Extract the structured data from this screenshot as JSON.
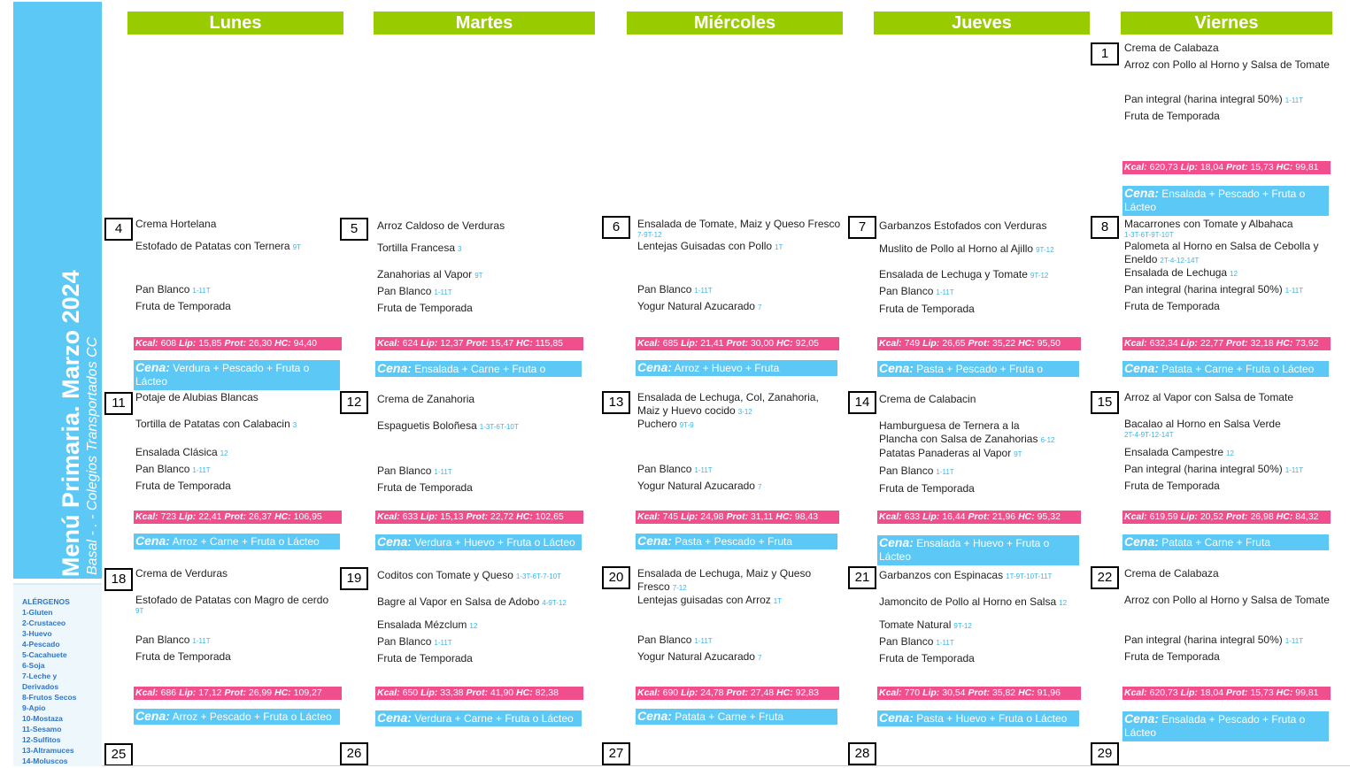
{
  "title": "Menú Primaria. Marzo 2024",
  "subtitle": "Basal - . - Colegios Transportados CC",
  "allergens": {
    "heading": "ALÉRGENOS",
    "items": [
      "1-Gluten",
      "2-Crustaceo",
      "3-Huevo",
      "4-Pescado",
      "5-Cacahuete",
      "6-Soja",
      "7-Leche y",
      "Derivados",
      "8-Frutos Secos",
      "9-Apio",
      "10-Mostaza",
      "11-Sesamo",
      "12-Sulfitos",
      "13-Altramuces",
      "14-Moluscos"
    ]
  },
  "days": [
    "Lunes",
    "Martes",
    "Miércoles",
    "Jueves",
    "Viernes"
  ],
  "dates": [
    "1",
    "4",
    "5",
    "6",
    "7",
    "8",
    "11",
    "12",
    "13",
    "14",
    "15",
    "18",
    "19",
    "20",
    "21",
    "22",
    "25",
    "26",
    "27",
    "28",
    "29"
  ],
  "colors": {
    "header": "#99cc00",
    "sidebar": "#5bc8f5",
    "kcal": "#f04e8c",
    "cena": "#5bc8f5",
    "allergen": "#3cb4e6"
  },
  "dishes": [
    {
      "t": "Crema de Calabaza",
      "a": ""
    },
    {
      "t": "Arroz con Pollo al Horno y Salsa de Tomate",
      "a": ""
    },
    {
      "t": "Pan integral (harina integral 50%)",
      "a": "1-11T"
    },
    {
      "t": "Fruta de Temporada",
      "a": ""
    },
    {
      "t": "Crema Hortelana",
      "a": ""
    },
    {
      "t": "Estofado de Patatas con Ternera",
      "a": "9T"
    },
    {
      "t": "Pan Blanco",
      "a": "1-11T"
    },
    {
      "t": "Fruta de Temporada",
      "a": ""
    },
    {
      "t": "Arroz Caldoso de Verduras",
      "a": ""
    },
    {
      "t": "Tortilla Francesa",
      "a": "3"
    },
    {
      "t": "Zanahorias al Vapor",
      "a": "9T"
    },
    {
      "t": "Pan Blanco",
      "a": "1-11T"
    },
    {
      "t": "Fruta de Temporada",
      "a": ""
    },
    {
      "t": "Ensalada de Tomate, Maiz y Queso Fresco",
      "a": "7-9T-12"
    },
    {
      "t": "Lentejas Guisadas con Pollo",
      "a": "1T"
    },
    {
      "t": "Pan Blanco",
      "a": "1-11T"
    },
    {
      "t": "Yogur Natural Azucarado",
      "a": "7"
    },
    {
      "t": "Garbanzos Estofados con Verduras",
      "a": ""
    },
    {
      "t": "Muslito de Pollo al Horno al Ajillo",
      "a": "9T-12"
    },
    {
      "t": "Ensalada de Lechuga y Tomate",
      "a": "9T-12"
    },
    {
      "t": "Pan Blanco",
      "a": "1-11T"
    },
    {
      "t": "Fruta de Temporada",
      "a": ""
    },
    {
      "t": "Macarrones con Tomate y Albahaca",
      "a": "1-3T-6T-9T-10T"
    },
    {
      "t": "Palometa al Horno en Salsa de Cebolla y Eneldo",
      "a": "2T-4-12-14T"
    },
    {
      "t": "Ensalada de Lechuga",
      "a": "12"
    },
    {
      "t": "Pan integral (harina integral 50%)",
      "a": "1-11T"
    },
    {
      "t": "Fruta de Temporada",
      "a": ""
    },
    {
      "t": "Potaje de Alubias Blancas",
      "a": ""
    },
    {
      "t": "Tortilla de Patatas con Calabacin",
      "a": "3"
    },
    {
      "t": "Ensalada Clásica",
      "a": "12"
    },
    {
      "t": "Pan Blanco",
      "a": "1-11T"
    },
    {
      "t": "Fruta de Temporada",
      "a": ""
    },
    {
      "t": "Crema de Zanahoria",
      "a": ""
    },
    {
      "t": "Espaguetis Boloñesa",
      "a": "1-3T-6T-10T"
    },
    {
      "t": "Pan Blanco",
      "a": "1-11T"
    },
    {
      "t": "Fruta de Temporada",
      "a": ""
    },
    {
      "t": "Ensalada de Lechuga, Col, Zanahoria, Maiz y Huevo cocido",
      "a": "3-12"
    },
    {
      "t": "Puchero",
      "a": "9T-9"
    },
    {
      "t": "Pan Blanco",
      "a": "1-11T"
    },
    {
      "t": "Yogur Natural Azucarado",
      "a": "7"
    },
    {
      "t": "Crema de Calabacin",
      "a": ""
    },
    {
      "t": "Hamburguesa de Ternera a la Plancha con Salsa de Zanahorias",
      "a": "6-12"
    },
    {
      "t": "Patatas Panaderas al Vapor",
      "a": "9T"
    },
    {
      "t": "Pan Blanco",
      "a": "1-11T"
    },
    {
      "t": "Fruta de Temporada",
      "a": ""
    },
    {
      "t": "Arroz al Vapor con Salsa de Tomate",
      "a": ""
    },
    {
      "t": "Bacalao al Horno en Salsa Verde",
      "a": "2T-4-9T-12-14T"
    },
    {
      "t": "Ensalada Campestre",
      "a": "12"
    },
    {
      "t": "Pan integral (harina integral 50%)",
      "a": "1-11T"
    },
    {
      "t": "Fruta de Temporada",
      "a": ""
    },
    {
      "t": "Crema de Verduras",
      "a": ""
    },
    {
      "t": "Estofado de Patatas con Magro de cerdo",
      "a": "9T"
    },
    {
      "t": "Pan Blanco",
      "a": "1-11T"
    },
    {
      "t": "Fruta de Temporada",
      "a": ""
    },
    {
      "t": "Coditos con Tomate y Queso",
      "a": "1-3T-6T-7-10T"
    },
    {
      "t": "Bagre al Vapor en Salsa de Adobo",
      "a": "4-9T-12"
    },
    {
      "t": "Ensalada Mézclum",
      "a": "12"
    },
    {
      "t": "Pan Blanco",
      "a": "1-11T"
    },
    {
      "t": "Fruta de Temporada",
      "a": ""
    },
    {
      "t": "Ensalada de Lechuga, Maiz y Queso Fresco",
      "a": "7-12"
    },
    {
      "t": "Lentejas guisadas con Arroz",
      "a": "1T"
    },
    {
      "t": "Pan Blanco",
      "a": "1-11T"
    },
    {
      "t": "Yogur Natural Azucarado",
      "a": "7"
    },
    {
      "t": "Garbanzos con Espinacas",
      "a": "1T-9T-10T-11T"
    },
    {
      "t": "Jamoncito de Pollo al Horno en Salsa",
      "a": "12"
    },
    {
      "t": "Tomate Natural",
      "a": "9T-12"
    },
    {
      "t": "Pan Blanco",
      "a": "1-11T"
    },
    {
      "t": "Fruta de Temporada",
      "a": ""
    },
    {
      "t": "Crema de Calabaza",
      "a": ""
    },
    {
      "t": "Arroz con Pollo al Horno y Salsa de Tomate",
      "a": ""
    },
    {
      "t": "Pan integral (harina integral 50%)",
      "a": "1-11T"
    },
    {
      "t": "Fruta de Temporada",
      "a": ""
    }
  ],
  "nutri": [
    {
      "kcal": "620,73",
      "lip": "18,04",
      "prot": "15,73",
      "hc": "99,81"
    },
    {
      "kcal": "608",
      "lip": "15,85",
      "prot": "26,30",
      "hc": "94,40"
    },
    {
      "kcal": "624",
      "lip": "12,37",
      "prot": "15,47",
      "hc": "115,85"
    },
    {
      "kcal": "685",
      "lip": "21,41",
      "prot": "30,00",
      "hc": "92,05"
    },
    {
      "kcal": "749",
      "lip": "26,65",
      "prot": "35,22",
      "hc": "95,50"
    },
    {
      "kcal": "632,34",
      "lip": "22,77",
      "prot": "32,18",
      "hc": "73,92"
    },
    {
      "kcal": "723",
      "lip": "22,41",
      "prot": "26,37",
      "hc": "106,95"
    },
    {
      "kcal": "633",
      "lip": "15,13",
      "prot": "22,72",
      "hc": "102,65"
    },
    {
      "kcal": "745",
      "lip": "24,98",
      "prot": "31,11",
      "hc": "98,43"
    },
    {
      "kcal": "633",
      "lip": "16,44",
      "prot": "21,96",
      "hc": "95,32"
    },
    {
      "kcal": "619,59",
      "lip": "20,52",
      "prot": "26,98",
      "hc": "84,32"
    },
    {
      "kcal": "686",
      "lip": "17,12",
      "prot": "26,99",
      "hc": "109,27"
    },
    {
      "kcal": "650",
      "lip": "33,38",
      "prot": "41,90",
      "hc": "82,38"
    },
    {
      "kcal": "690",
      "lip": "24,78",
      "prot": "27,48",
      "hc": "92,83"
    },
    {
      "kcal": "770",
      "lip": "30,54",
      "prot": "35,82",
      "hc": "91,96"
    },
    {
      "kcal": "620,73",
      "lip": "18,04",
      "prot": "15,73",
      "hc": "99,81"
    }
  ],
  "nutri_labels": {
    "kcal": "Kcal:",
    "lip": "Lip:",
    "prot": "Prot:",
    "hc": "HC:"
  },
  "cena_label": "Cena:",
  "cenas": [
    "Ensalada + Pescado + Fruta o Lácteo",
    "Verdura + Pescado + Fruta o Lácteo",
    "Ensalada + Carne + Fruta o Lácteo",
    "Arroz + Huevo + Fruta",
    "Pasta + Pescado + Fruta o Lácteo",
    "Patata + Carne + Fruta o Lácteo",
    "Arroz + Carne + Fruta o Lácteo",
    "Verdura + Huevo + Fruta o Lácteo",
    "Pasta + Pescado + Fruta",
    "Ensalada + Huevo + Fruta o Lácteo",
    "Patata + Carne + Fruta",
    "Arroz + Pescado + Fruta o Lácteo",
    "Verdura + Carne + Fruta o Lácteo",
    "Patata + Carne + Fruta",
    "Pasta + Huevo + Fruta  o Lácteo",
    "Ensalada + Pescado + Fruta o Lácteo"
  ]
}
